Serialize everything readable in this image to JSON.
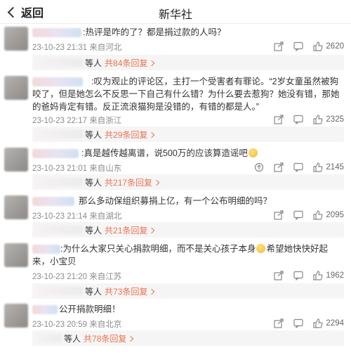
{
  "header": {
    "back_label": "返回",
    "title": "新华社"
  },
  "comments": [
    {
      "text": ":热评是咋的了？都是捐过款的人吗？",
      "time": "23-10-23 21:31",
      "location": "来自河北",
      "likes": "2620",
      "reply_who": "等人",
      "reply_link": "共84条回复",
      "has_emoji": false
    },
    {
      "text": ":叹为观止的评论区，主打一个受害者有罪论。“2岁女童虽然被狗咬了，但是她怎么不反思一下自己有什么错？为什么要去惹狗？她没有错，那她的爸妈肯定有错。反正流浪猫狗是没错的，有错的都是人。”",
      "time": "23-10-23 22:17",
      "location": "来自浙江",
      "likes": "2325",
      "reply_who": "等人",
      "reply_link": "共29条回复",
      "has_emoji": false
    },
    {
      "text": ":真是越传越离谱，说500万的应该算造谣吧",
      "time": "23-10-23 21:01",
      "location": "来自山东",
      "likes": "2145",
      "reply_who": "等人",
      "reply_link": "共217条回复",
      "has_emoji": true
    },
    {
      "text": "那么多动保组织募捐上亿，有一个公布明细的吗？",
      "time": "23-10-23 21:14",
      "location": "来自湖北",
      "likes": "2095",
      "reply_who": "等人",
      "reply_link": "共21条回复",
      "has_emoji": false
    },
    {
      "text": ":为什么大家只关心捐款明细，而不是关心孩子本身",
      "text_after_emoji": "希望她快快好起来，小宝贝",
      "time": "23-10-23 21:20",
      "location": "来自江苏",
      "likes": "1962",
      "reply_who": "等人",
      "reply_link": "共73条回复",
      "has_emoji": true
    },
    {
      "text": "公开捐款明细！",
      "time": "23-10-23 20:59",
      "location": "来自北京",
      "likes": "2294",
      "reply_who": "等人",
      "reply_link": "共78条回复",
      "has_emoji": false
    }
  ],
  "icons": [
    "share-icon",
    "comment-icon",
    "like-icon",
    "vote-icon"
  ],
  "colors": {
    "accent": "#eb7350",
    "meta": "#8a8a8a",
    "reply_bg": "#f5f5f5"
  }
}
